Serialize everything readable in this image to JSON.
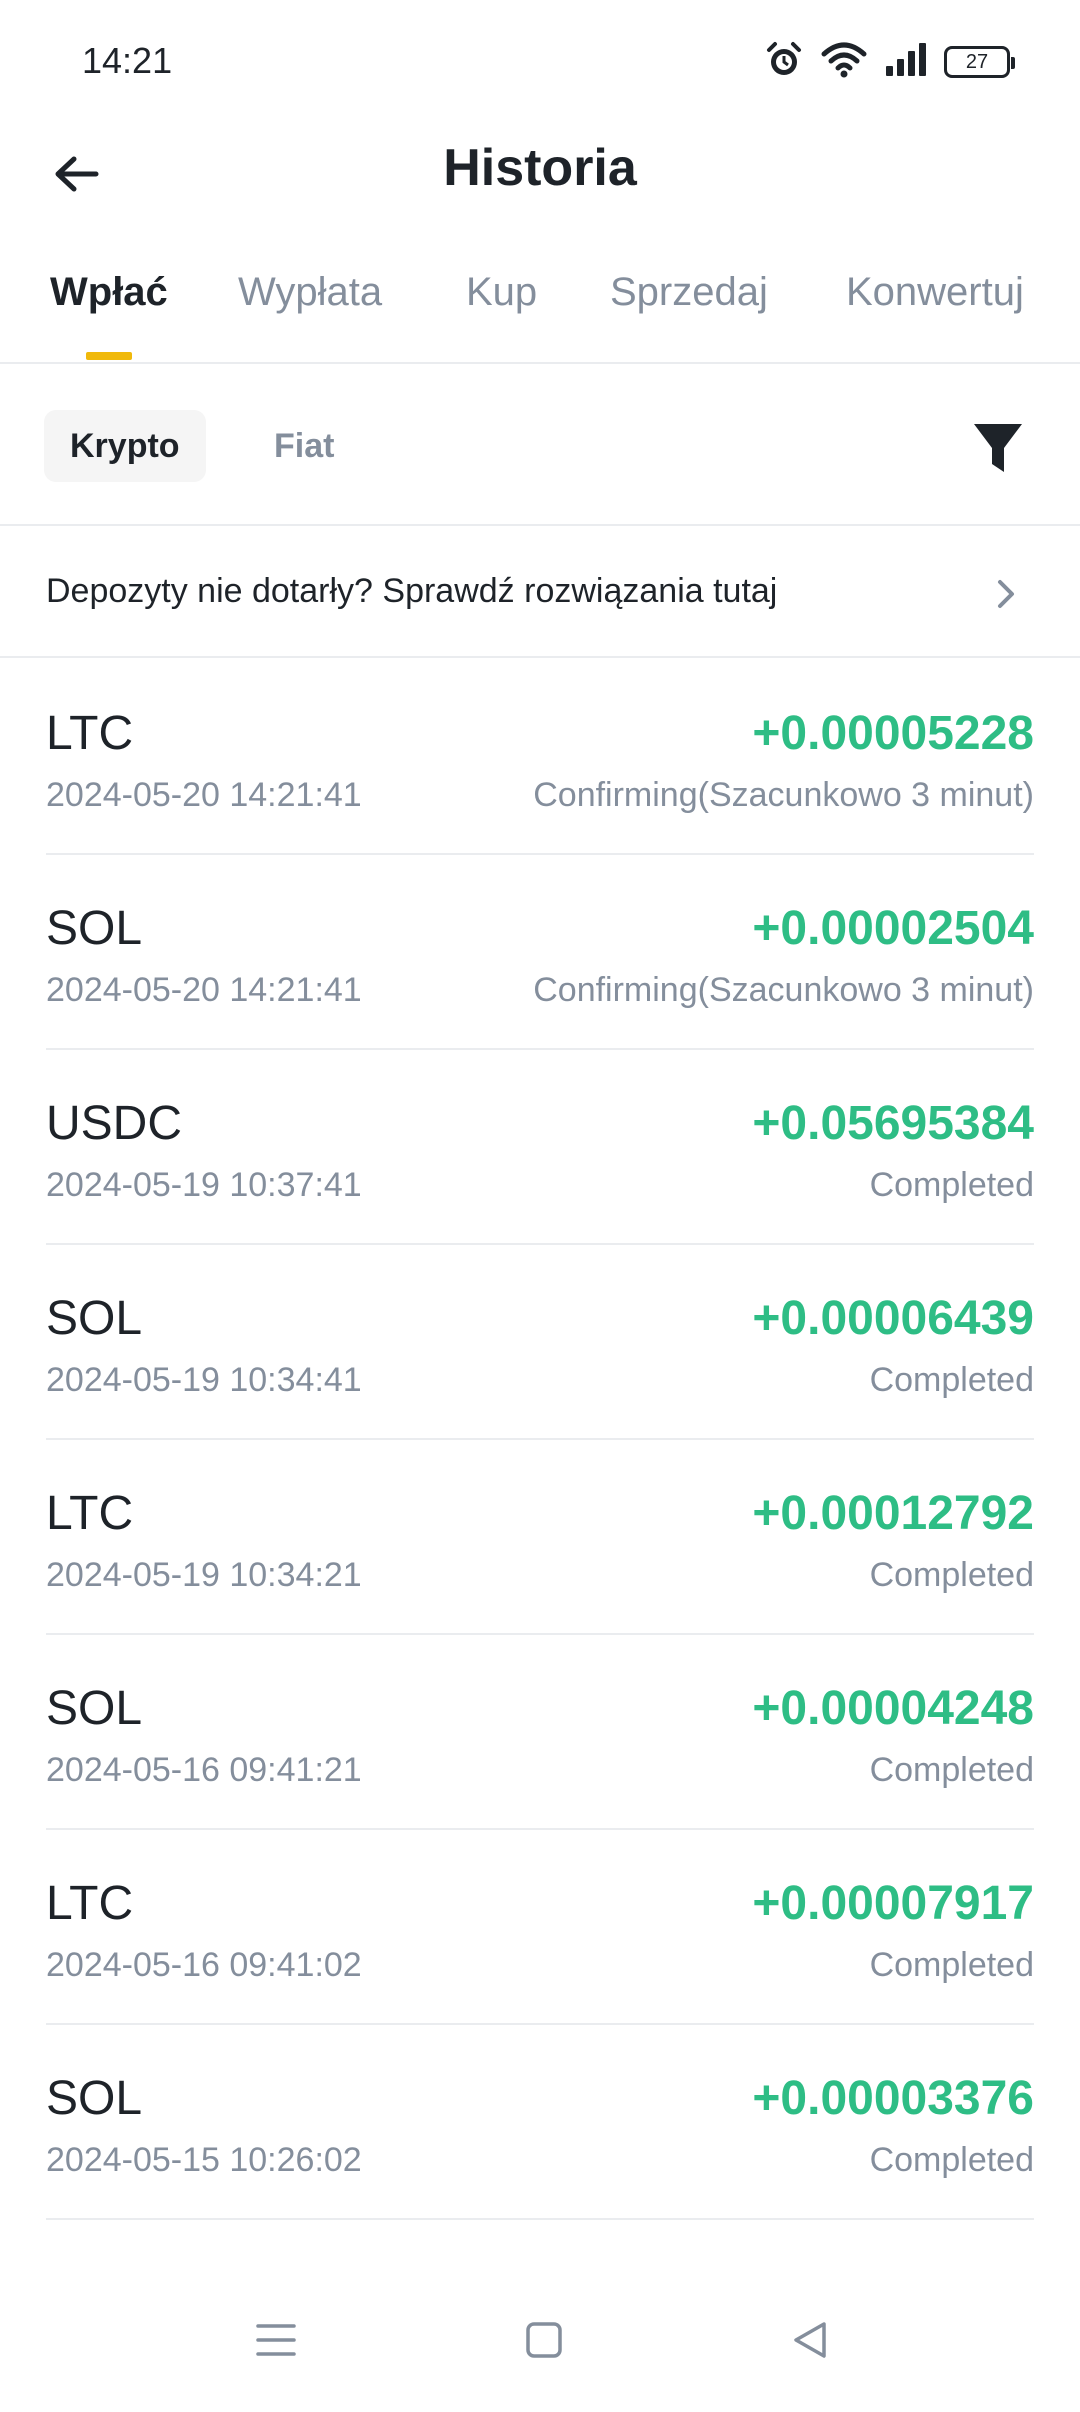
{
  "status_bar": {
    "time": "14:21",
    "battery": "27",
    "icons": [
      "alarm-icon",
      "wifi-icon",
      "signal-icon",
      "battery-icon"
    ]
  },
  "header": {
    "title": "Historia",
    "back_icon": "arrow-left-icon"
  },
  "tabs": [
    {
      "label": "Wpłać",
      "active": true
    },
    {
      "label": "Wypłata",
      "active": false
    },
    {
      "label": "Kup",
      "active": false
    },
    {
      "label": "Sprzedaj",
      "active": false
    },
    {
      "label": "Konwertuj",
      "active": false
    }
  ],
  "subtabs": {
    "crypto": "Krypto",
    "fiat": "Fiat",
    "filter_icon": "filter-icon"
  },
  "notice": {
    "text": "Depozyty nie dotarły? Sprawdź rozwiązania tutaj",
    "chevron_icon": "chevron-right-icon"
  },
  "transactions": [
    {
      "coin": "LTC",
      "date": "2024-05-20 14:21:41",
      "amount": "+0.00005228",
      "status": "Confirming(Szacunkowo 3 minut)"
    },
    {
      "coin": "SOL",
      "date": "2024-05-20 14:21:41",
      "amount": "+0.00002504",
      "status": "Confirming(Szacunkowo 3 minut)"
    },
    {
      "coin": "USDC",
      "date": "2024-05-19 10:37:41",
      "amount": "+0.05695384",
      "status": "Completed"
    },
    {
      "coin": "SOL",
      "date": "2024-05-19 10:34:41",
      "amount": "+0.00006439",
      "status": "Completed"
    },
    {
      "coin": "LTC",
      "date": "2024-05-19 10:34:21",
      "amount": "+0.00012792",
      "status": "Completed"
    },
    {
      "coin": "SOL",
      "date": "2024-05-16 09:41:21",
      "amount": "+0.00004248",
      "status": "Completed"
    },
    {
      "coin": "LTC",
      "date": "2024-05-16 09:41:02",
      "amount": "+0.00007917",
      "status": "Completed"
    },
    {
      "coin": "SOL",
      "date": "2024-05-15 10:26:02",
      "amount": "+0.00003376",
      "status": "Completed"
    }
  ],
  "colors": {
    "accent": "#f0b90b",
    "positive": "#2ebd85",
    "text_primary": "#1e2329",
    "text_secondary": "#848e9c"
  },
  "nav_bar": {
    "icons": [
      "menu-icon",
      "home-icon",
      "back-icon"
    ]
  }
}
